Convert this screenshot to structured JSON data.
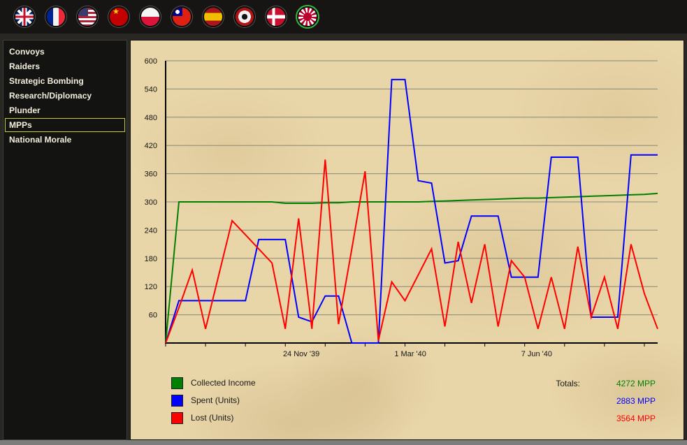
{
  "topbar": {
    "flags": [
      {
        "id": "uk",
        "name": "uk-flag",
        "selected": false
      },
      {
        "id": "france",
        "name": "france-flag",
        "selected": false
      },
      {
        "id": "usa",
        "name": "usa-flag",
        "selected": false
      },
      {
        "id": "ussr",
        "name": "ussr-flag",
        "selected": false
      },
      {
        "id": "poland",
        "name": "poland-flag",
        "selected": false
      },
      {
        "id": "china",
        "name": "china-flag",
        "selected": false
      },
      {
        "id": "spain",
        "name": "spain-flag",
        "selected": false
      },
      {
        "id": "germany",
        "name": "germany-flag",
        "selected": false
      },
      {
        "id": "denmark",
        "name": "denmark-flag",
        "selected": false
      },
      {
        "id": "japan",
        "name": "japan-flag",
        "selected": true
      }
    ]
  },
  "sidebar": {
    "items": [
      {
        "label": "Convoys",
        "selected": false
      },
      {
        "label": "Raiders",
        "selected": false
      },
      {
        "label": "Strategic Bombing",
        "selected": false
      },
      {
        "label": "Research/Diplomacy",
        "selected": false
      },
      {
        "label": "Plunder",
        "selected": false
      },
      {
        "label": "MPPs",
        "selected": true
      },
      {
        "label": "National Morale",
        "selected": false
      }
    ]
  },
  "totals_label": "Totals:",
  "chart_data": {
    "type": "line",
    "title": "",
    "xlabel": "",
    "ylabel": "",
    "ylim": [
      0,
      600
    ],
    "yticks": [
      60,
      120,
      180,
      240,
      300,
      360,
      420,
      480,
      540,
      600
    ],
    "grid": true,
    "grid_color": "#8a8876",
    "axis_color": "#000000",
    "legend_position": "bottom-left",
    "x_labels": [
      {
        "label": "24 Nov '39",
        "index": 10.2
      },
      {
        "label": "1 Mar '40",
        "index": 18.4
      },
      {
        "label": "7 Jun '40",
        "index": 27.9
      }
    ],
    "series": [
      {
        "name": "Collected Income",
        "color": "#008000",
        "total": "4272 MPP",
        "values": [
          0,
          300,
          300,
          300,
          300,
          300,
          300,
          300,
          300,
          297,
          297,
          297,
          298,
          298,
          300,
          300,
          300,
          300,
          300,
          300,
          301,
          302,
          303,
          304,
          305,
          306,
          307,
          308,
          308,
          309,
          310,
          311,
          312,
          313,
          314,
          315,
          316,
          318
        ]
      },
      {
        "name": "Spent (Units)",
        "color": "#0000ff",
        "total": "2883 MPP",
        "values": [
          0,
          90,
          90,
          90,
          90,
          90,
          90,
          220,
          220,
          220,
          55,
          45,
          100,
          100,
          0,
          0,
          0,
          560,
          560,
          345,
          340,
          170,
          175,
          270,
          270,
          270,
          140,
          140,
          140,
          395,
          395,
          395,
          55,
          55,
          55,
          400,
          400,
          400
        ]
      },
      {
        "name": "Lost (Units)",
        "color": "#ff0000",
        "total": "3564 MPP",
        "values": [
          0,
          75,
          155,
          30,
          145,
          260,
          230,
          200,
          170,
          30,
          265,
          30,
          390,
          40,
          200,
          365,
          5,
          130,
          90,
          145,
          200,
          35,
          215,
          85,
          210,
          35,
          175,
          140,
          30,
          140,
          30,
          205,
          55,
          140,
          30,
          210,
          105,
          30
        ]
      }
    ]
  }
}
